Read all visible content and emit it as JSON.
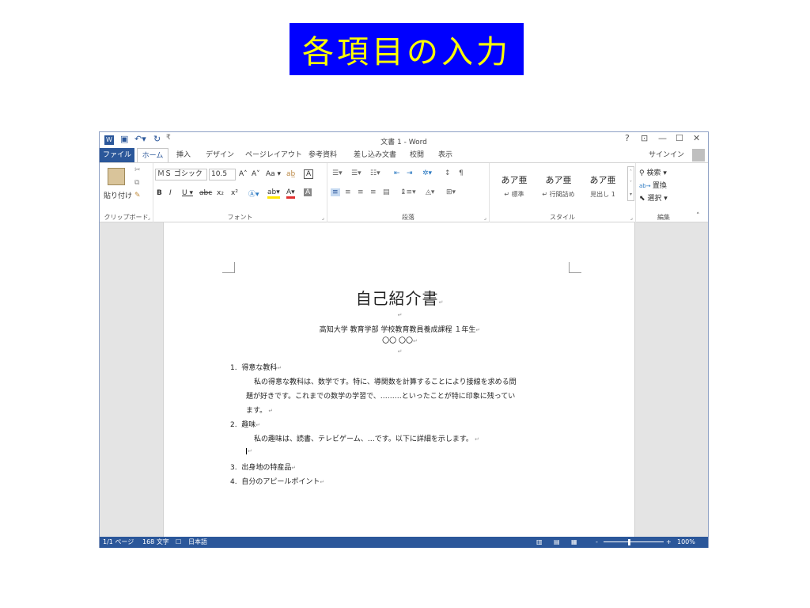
{
  "slide": {
    "title": "各項目の入力"
  },
  "window": {
    "doc_title": "文書 1 - Word",
    "help": "?",
    "controls": {
      "ribbon_display": "⊡",
      "minimize": "—",
      "maximize": "☐",
      "close": "✕"
    }
  },
  "tabs": {
    "file": "ファイル",
    "items": [
      "ホーム",
      "挿入",
      "デザイン",
      "ページレイアウト",
      "参考資料",
      "差し込み文書",
      "校閲",
      "表示"
    ],
    "signin": "サインイン"
  },
  "ribbon": {
    "clipboard": {
      "paste": "貼り付け",
      "label": "クリップボード"
    },
    "font": {
      "name": "ＭＳ ゴシック",
      "size": "10.5",
      "buttons": [
        "A˄",
        "A˅",
        "Aa ▾",
        "ab̲",
        "A"
      ],
      "format_buttons": [
        "B",
        "I",
        "U ▾",
        "abc",
        "x₂",
        "x²"
      ],
      "label": "フォント"
    },
    "paragraph": {
      "label": "段落"
    },
    "styles": {
      "items": [
        {
          "sample": "あア亜",
          "name": "↵ 標準"
        },
        {
          "sample": "あア亜",
          "name": "↵ 行間詰め"
        },
        {
          "sample": "あア亜",
          "name": "見出し 1"
        }
      ],
      "label": "スタイル"
    },
    "editing": {
      "find": "検索 ▾",
      "replace": "置換",
      "select": "選択 ▾",
      "label": "編集"
    }
  },
  "document": {
    "heading": "自己紹介書",
    "affiliation": "高知大学 教育学部 学校教育教員養成課程 １年生",
    "name": "〇〇 〇〇",
    "items": [
      {
        "num": "1.",
        "title": "得意な教科",
        "body": [
          "私の得意な教科は、数学です。特に、導関数を計算することにより接線を求める問",
          "題が好きです。これまでの数学の学習で、………といったことが特に印象に残ってい",
          "ます。"
        ]
      },
      {
        "num": "2.",
        "title": "趣味",
        "body": [
          "私の趣味は、読書、テレビゲーム、…です。以下に詳細を示します。"
        ]
      },
      {
        "num": "3.",
        "title": "出身地の特産品",
        "body": []
      },
      {
        "num": "4.",
        "title": "自分のアピールポイント",
        "body": []
      }
    ]
  },
  "statusbar": {
    "page": "1/1 ページ",
    "words": "168 文字",
    "language": "日本語",
    "zoom_out": "-",
    "zoom_in": "+",
    "zoom": "100%"
  },
  "colors": {
    "accent": "#2b579a",
    "slide_title_bg": "#0000ff",
    "slide_title_fg": "#ffff00"
  }
}
